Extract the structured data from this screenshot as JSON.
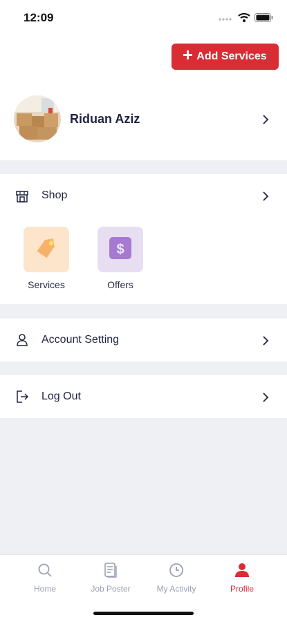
{
  "status_bar": {
    "time": "12:09"
  },
  "header": {
    "add_button_label": "Add Services"
  },
  "profile": {
    "name": "Riduan Aziz"
  },
  "shop": {
    "title": "Shop",
    "tiles": [
      {
        "label": "Services",
        "icon": "tag-icon",
        "bg": "#fde5cc"
      },
      {
        "label": "Offers",
        "icon": "dollar-icon",
        "bg": "#e8def2"
      }
    ]
  },
  "menu": {
    "account_setting": "Account Setting",
    "log_out": "Log Out"
  },
  "bottom_nav": {
    "items": [
      {
        "label": "Home",
        "icon": "search-icon"
      },
      {
        "label": "Job Poster",
        "icon": "document-icon"
      },
      {
        "label": "My Activity",
        "icon": "clock-icon"
      },
      {
        "label": "Profile",
        "icon": "person-icon",
        "active": true
      }
    ]
  },
  "colors": {
    "accent": "#d92c35",
    "text": "#1f2340",
    "muted": "#9aa0b4",
    "background": "#eef0f4"
  }
}
